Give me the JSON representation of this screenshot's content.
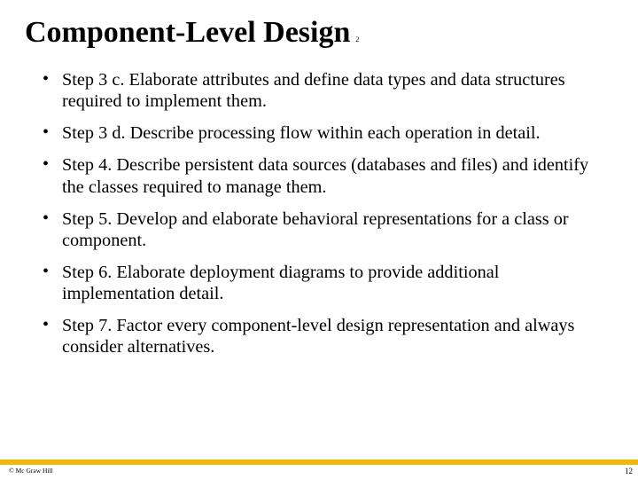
{
  "title": "Component-Level Design",
  "titleSubscript": "2",
  "bullets": [
    "Step 3 c. Elaborate attributes and define data types and data structures required to implement them.",
    "Step 3 d. Describe processing flow within each operation in detail.",
    "Step 4. Describe persistent data sources (databases and files) and identify the classes required to manage them.",
    "Step 5. Develop and elaborate behavioral representations for a class or component.",
    "Step 6. Elaborate deployment diagrams to provide additional implementation detail.",
    "Step 7. Factor every component-level design representation and always consider alternatives."
  ],
  "copyright": "© Mc Graw Hill",
  "pageNumber": "12"
}
